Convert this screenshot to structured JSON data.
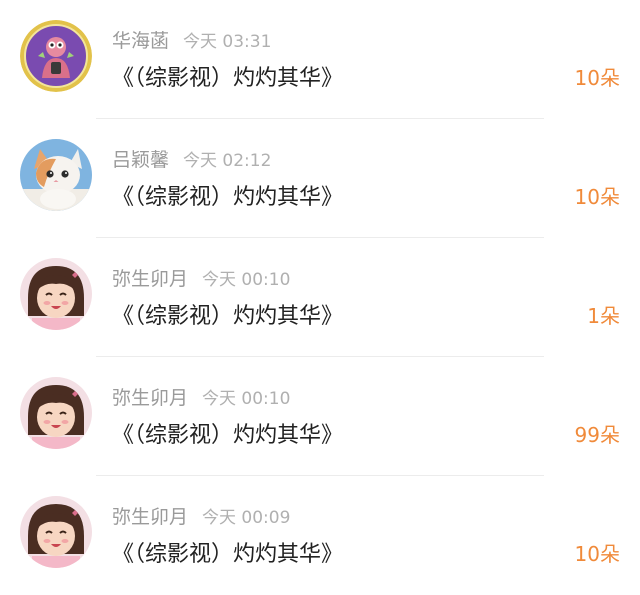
{
  "gifts": [
    {
      "user": "华海菡",
      "time": "今天 03:31",
      "book": "《（综影视）灼灼其华》",
      "amount": "10朵",
      "avatar_icon": "cartoon-character-avatar"
    },
    {
      "user": "吕颖馨",
      "time": "今天 02:12",
      "book": "《（综影视）灼灼其华》",
      "amount": "10朵",
      "avatar_icon": "kitten-photo-avatar"
    },
    {
      "user": "弥生卯月",
      "time": "今天 00:10",
      "book": "《（综影视）灼灼其华》",
      "amount": "1朵",
      "avatar_icon": "girl-photo-avatar"
    },
    {
      "user": "弥生卯月",
      "time": "今天 00:10",
      "book": "《（综影视）灼灼其华》",
      "amount": "99朵",
      "avatar_icon": "girl-photo-avatar"
    },
    {
      "user": "弥生卯月",
      "time": "今天 00:09",
      "book": "《（综影视）灼灼其华》",
      "amount": "10朵",
      "avatar_icon": "girl-photo-avatar"
    }
  ],
  "colors": {
    "amount": "#f08a3a",
    "name": "#9a9a9a",
    "time": "#b0b0b0",
    "title": "#222222",
    "divider": "#ececec"
  }
}
